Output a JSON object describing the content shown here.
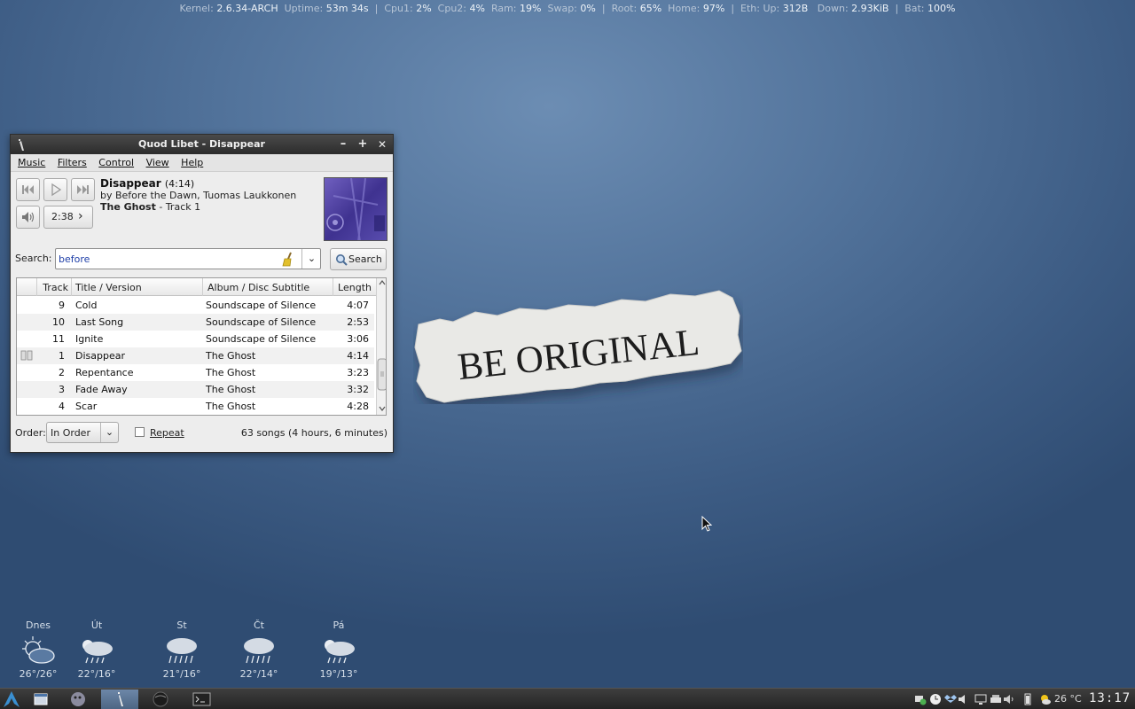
{
  "conky": {
    "kernel_label": "Kernel:",
    "kernel": "2.6.34-ARCH",
    "uptime_label": "Uptime:",
    "uptime": "53m 34s",
    "cpu1_label": "Cpu1:",
    "cpu1": "2%",
    "cpu2_label": "Cpu2:",
    "cpu2": "4%",
    "ram_label": "Ram:",
    "ram": "19%",
    "swap_label": "Swap:",
    "swap": "0%",
    "root_label": "Root:",
    "root": "65%",
    "home_label": "Home:",
    "home": "97%",
    "eth_label": "Eth: Up:",
    "eth_up": "312B",
    "down_label": "Down:",
    "down": "2.93KiB",
    "bat_label": "Bat:",
    "bat": "100%",
    "separator": "|"
  },
  "wallpaper": {
    "text": "BE ORIGINAL"
  },
  "window": {
    "title": "Quod Libet - Disappear",
    "minimize": "–",
    "maximize": "+",
    "close": "✕"
  },
  "menu": {
    "music": "Music",
    "filters": "Filters",
    "control": "Control",
    "view": "View",
    "help": "Help"
  },
  "player": {
    "time": "2:38",
    "song_title": "Disappear",
    "song_length": "(4:14)",
    "artist_line": "by Before the Dawn, Tuomas Laukkonen",
    "album": "The Ghost",
    "track_suffix": " - Track 1"
  },
  "search": {
    "label": "Search:",
    "value": "before",
    "button_label": "Search"
  },
  "table": {
    "headers": {
      "track": "Track",
      "title": "Title / Version",
      "album": "Album / Disc Subtitle",
      "length": "Length"
    },
    "rows": [
      {
        "track": "9",
        "title": "Cold",
        "album": "Soundscape of Silence",
        "length": "4:07"
      },
      {
        "track": "10",
        "title": "Last Song",
        "album": "Soundscape of Silence",
        "length": "2:53"
      },
      {
        "track": "11",
        "title": "Ignite",
        "album": "Soundscape of Silence",
        "length": "3:06"
      },
      {
        "track": "1",
        "title": "Disappear",
        "album": "The Ghost",
        "length": "4:14"
      },
      {
        "track": "2",
        "title": "Repentance",
        "album": "The Ghost",
        "length": "3:23"
      },
      {
        "track": "3",
        "title": "Fade Away",
        "album": "The Ghost",
        "length": "3:32"
      },
      {
        "track": "4",
        "title": "Scar",
        "album": "The Ghost",
        "length": "4:28"
      }
    ]
  },
  "footer": {
    "order_label": "Order:",
    "order_value": "In Order",
    "repeat_label": "Repeat",
    "status": "63 songs (4 hours, 6 minutes)"
  },
  "weather": [
    {
      "day": "Dnes",
      "temp": "26°/26°",
      "icon": "sun-cloud-icon"
    },
    {
      "day": "Út",
      "temp": "22°/16°",
      "icon": "sun-rain-icon"
    },
    {
      "day": "St",
      "temp": "21°/16°",
      "icon": "rain-icon"
    },
    {
      "day": "Čt",
      "temp": "22°/14°",
      "icon": "rain-icon"
    },
    {
      "day": "Pá",
      "temp": "19°/13°",
      "icon": "sun-rain-icon"
    }
  ],
  "tray": {
    "temperature": "26 °C",
    "clock": "13:17"
  },
  "colors": {
    "desktop": "#52739b",
    "titlebar": "#2c2c2c",
    "search_text": "#1f3fa8",
    "taskbar_active": "#5a7496"
  }
}
